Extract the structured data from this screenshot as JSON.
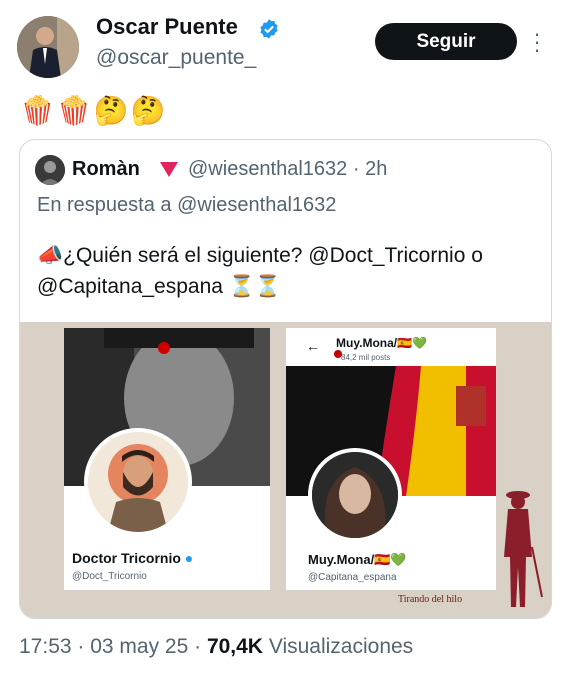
{
  "author": {
    "name": "Oscar Puente",
    "handle": "@oscar_puente_",
    "follow_label": "Seguir"
  },
  "tweet_text": "🍿🍿🤔🤔",
  "quoted": {
    "name": "Romàn",
    "handle": "@wiesenthal1632 · 2h",
    "reply_prefix": "En respuesta a ",
    "reply_to": "@wiesenthal1632",
    "text": "📣¿Quién será el siguiente? @Doct_Tricornio o @Capitana_espana ⏳⏳",
    "image": {
      "left_profile_name": "Doctor Tricornio",
      "left_profile_handle": "@Doct_Tricornio",
      "right_profile_top": "Muy.Mona/🇪🇸💚",
      "right_profile_posts": "84,2 mil posts",
      "right_profile_name": "Muy.Mona/🇪🇸💚",
      "right_profile_handle": "@Capitana_espana",
      "caption": "Tirando del hilo"
    }
  },
  "stats": {
    "time": "17:53 · 03 may 25 · ",
    "views": "70,4K",
    "views_label": " Visualizaciones"
  },
  "icons": [
    "verified-badge-icon",
    "more-options-icon",
    "back-arrow-icon",
    "red-triangle-flag-icon"
  ],
  "colors": {
    "verified": "#1d9bf0",
    "follow_bg": "#0f1419",
    "muted": "#536471"
  }
}
